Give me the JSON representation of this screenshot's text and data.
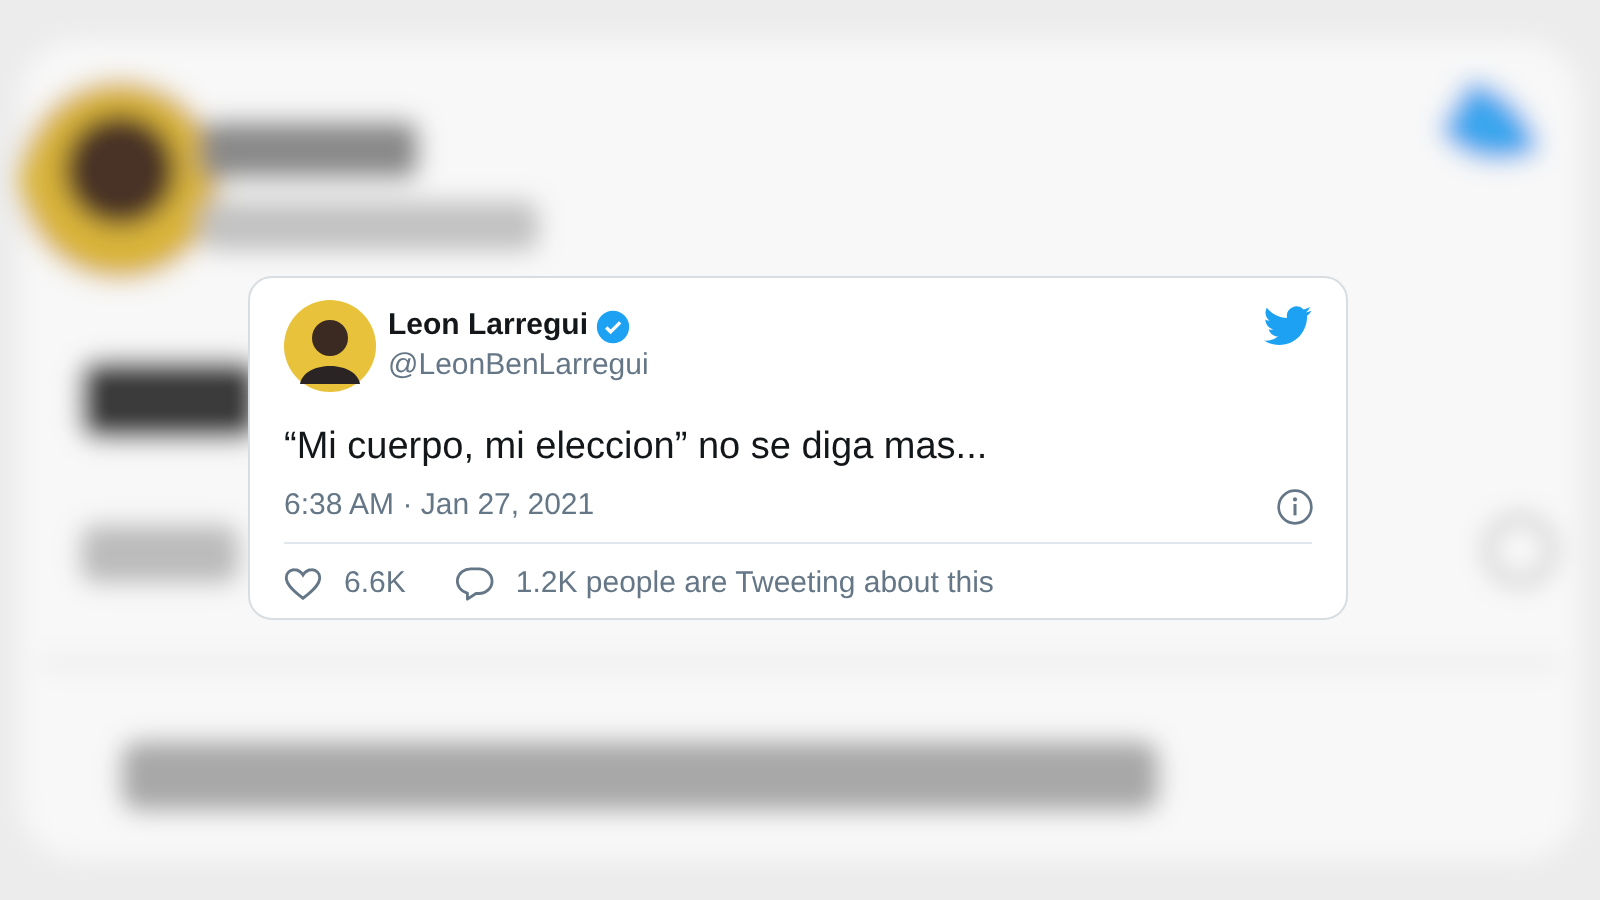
{
  "tweet": {
    "author": {
      "name": "Leon Larregui",
      "verified": true,
      "handle": "@LeonBenLarregui"
    },
    "text": "“Mi cuerpo, mi eleccion” no se diga mas...",
    "timestamp": "6:38 AM · Jan 27, 2021",
    "likes": "6.6K",
    "conversation": "1.2K people are Tweeting about this"
  }
}
